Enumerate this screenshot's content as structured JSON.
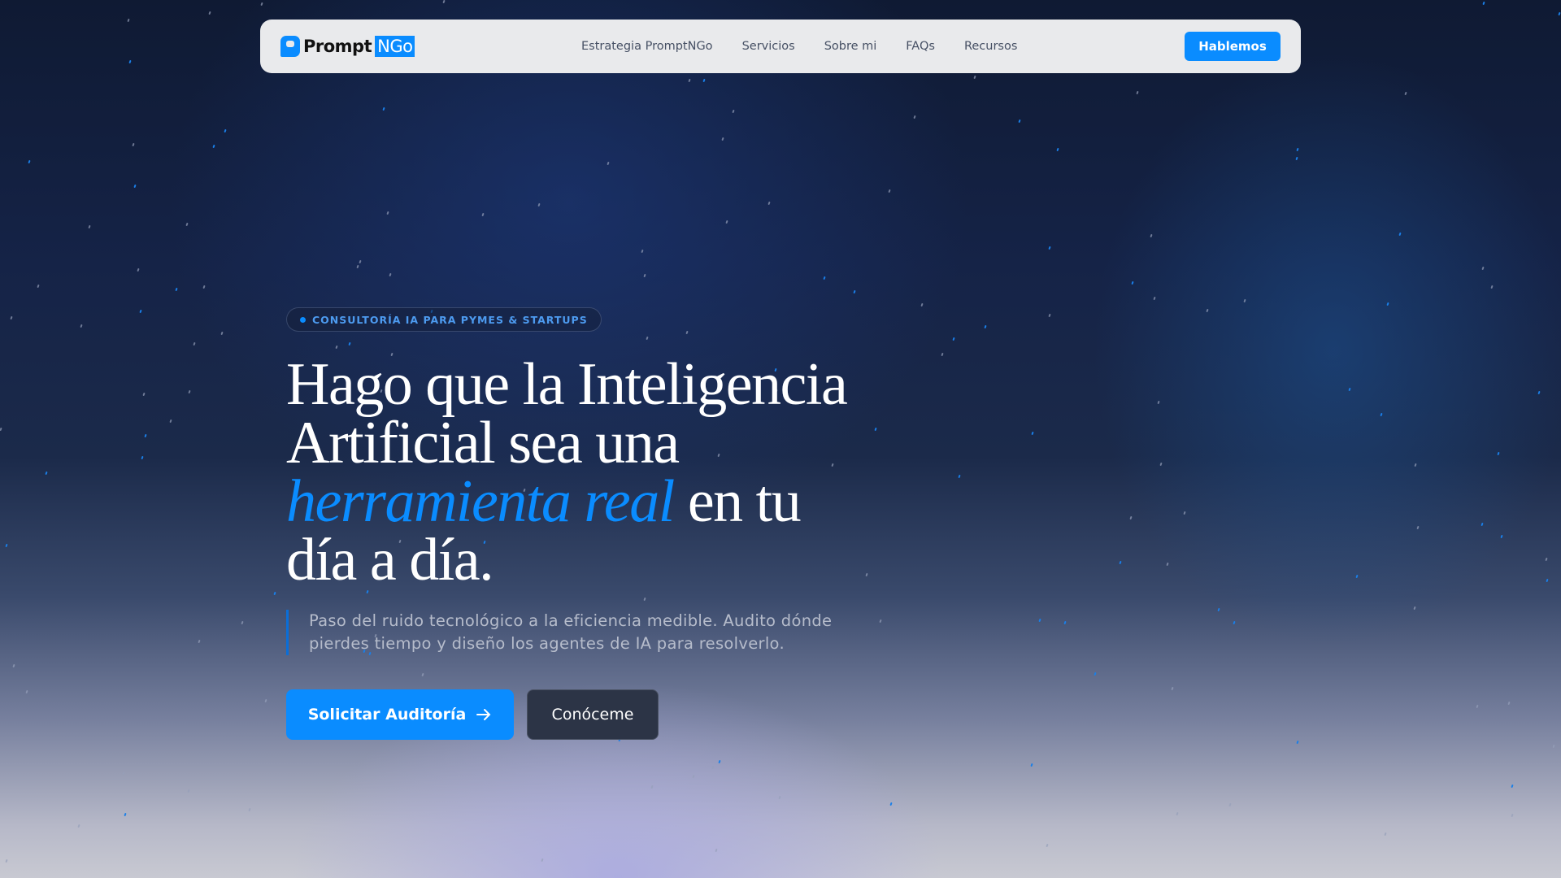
{
  "nav": {
    "logo_text": "Prompt",
    "logo_highlight": "NGo",
    "links": [
      "Estrategia PromptNGo",
      "Servicios",
      "Sobre mi",
      "FAQs",
      "Recursos"
    ],
    "cta": "Hablemos"
  },
  "hero": {
    "badge": "CONSULTORÍA IA PARA PYMES & STARTUPS",
    "title_part1": "Hago que la Inteligencia Artificial sea una",
    "title_highlight": "herramienta real",
    "title_part2": "en tu día a día.",
    "lead": "Paso del ruido tecnológico a la eficiencia medible. Audito dónde pierdes tiempo y diseño los agentes de IA para resolverlo.",
    "primary_button": "Solicitar Auditoría",
    "secondary_button": "Conóceme"
  },
  "colors": {
    "accent": "#0a8cff",
    "background": "#152347"
  }
}
